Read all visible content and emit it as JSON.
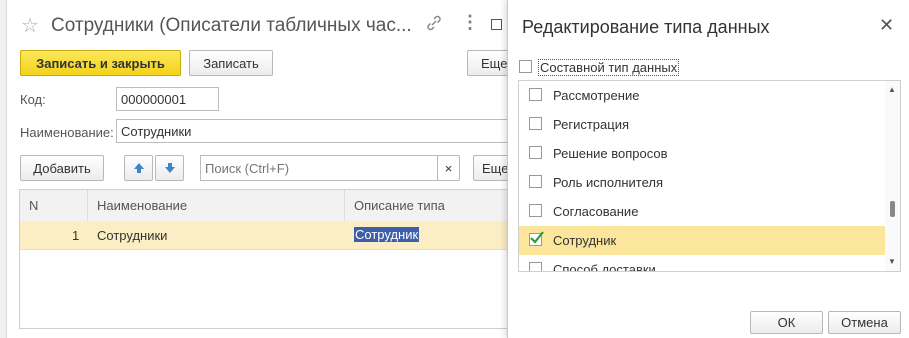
{
  "main_window": {
    "title": "Сотрудники (Описатели табличных час...",
    "buttons": {
      "save_close": "Записать и закрыть",
      "save": "Записать",
      "more_top": "Еще"
    },
    "code_label": "Код:",
    "code_value": "000000001",
    "name_label": "Наименование:",
    "name_value": "Сотрудники",
    "toolbar": {
      "add": "Добавить",
      "search_placeholder": "Поиск (Ctrl+F)",
      "clear": "×",
      "more": "Еще"
    },
    "table": {
      "headers": [
        "N",
        "Наименование",
        "Описание типа"
      ],
      "rows": [
        {
          "n": "1",
          "name": "Сотрудники",
          "type_desc": "Сотрудник"
        }
      ]
    }
  },
  "dialog": {
    "title": "Редактирование типа данных",
    "composite_label": "Составной тип данных",
    "composite_checked": false,
    "items": [
      {
        "label": "Рассмотрение",
        "checked": false
      },
      {
        "label": "Регистрация",
        "checked": false
      },
      {
        "label": "Решение вопросов",
        "checked": false
      },
      {
        "label": "Роль исполнителя",
        "checked": false
      },
      {
        "label": "Согласование",
        "checked": false
      },
      {
        "label": "Сотрудник",
        "checked": true
      },
      {
        "label": "Способ доставки",
        "checked": false
      }
    ],
    "ok": "ОК",
    "cancel": "Отмена"
  },
  "colors": {
    "accent_yellow": "#f4d21a",
    "selection": "#fbe69c",
    "highlight_text_bg": "#3d5ea8",
    "check_green": "#2f9a3a"
  }
}
